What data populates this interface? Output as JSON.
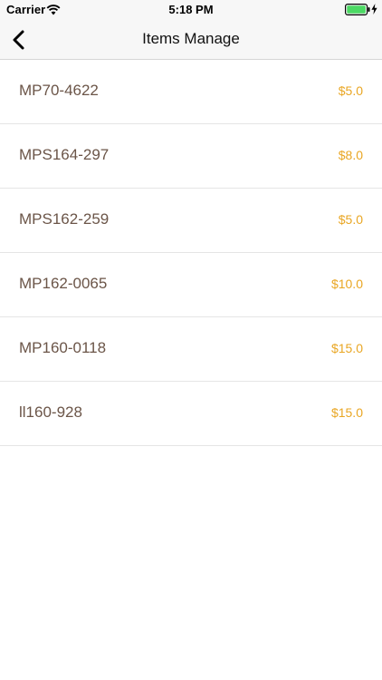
{
  "status_bar": {
    "carrier": "Carrier",
    "time": "5:18 PM",
    "battery_color": "#4cd964"
  },
  "nav": {
    "title": "Items Manage",
    "back_icon": "chevron-left-icon"
  },
  "items": [
    {
      "name": "MP70-4622",
      "price": "$5.0"
    },
    {
      "name": "MPS164-297",
      "price": "$8.0"
    },
    {
      "name": "MPS162-259",
      "price": "$5.0"
    },
    {
      "name": "MP162-0065",
      "price": "$10.0"
    },
    {
      "name": "MP160-0118",
      "price": "$15.0"
    },
    {
      "name": "ll160-928",
      "price": "$15.0"
    }
  ],
  "colors": {
    "item_name": "#6b5548",
    "item_price": "#e9a623",
    "bar_background": "#f7f7f7"
  }
}
